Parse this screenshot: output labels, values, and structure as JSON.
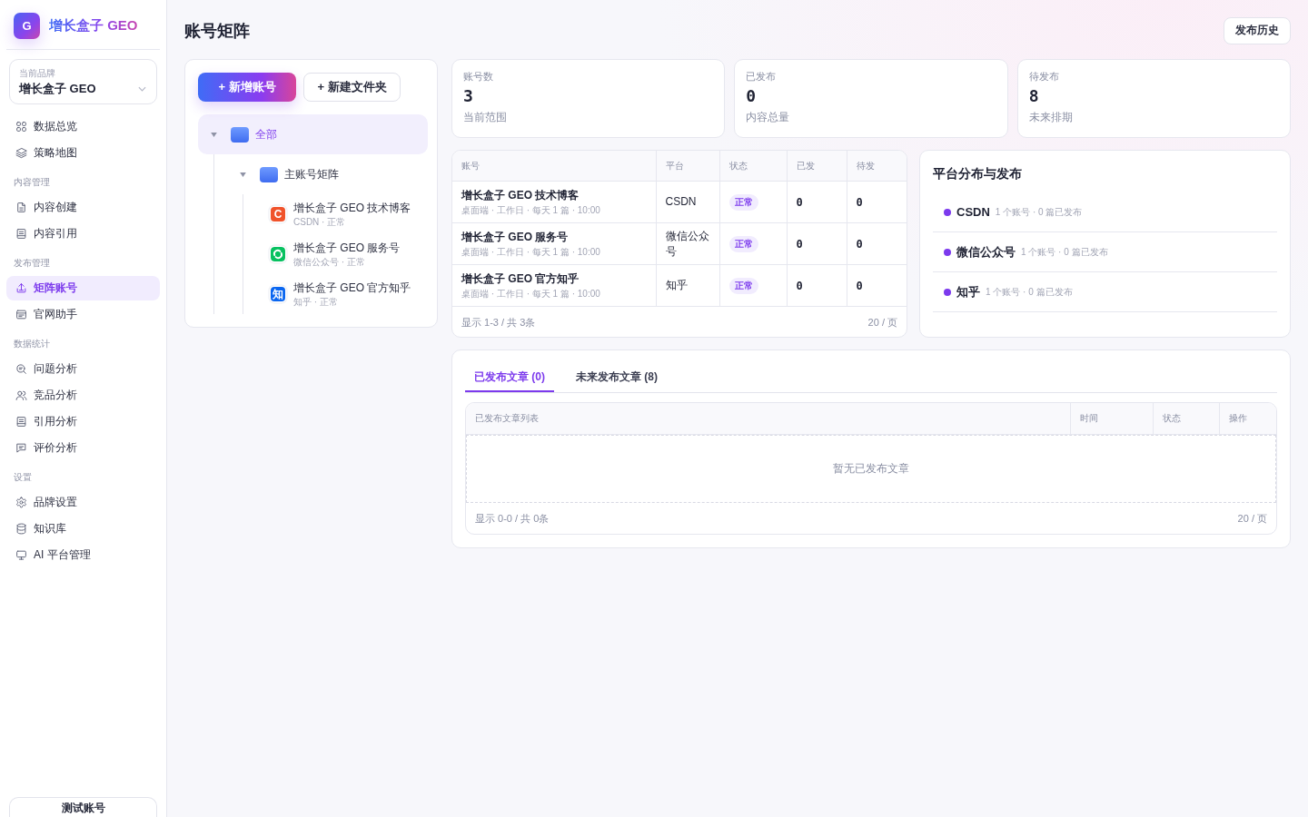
{
  "brand": {
    "logo_letter": "G",
    "name": "增长盒子 GEO"
  },
  "brand_select": {
    "label": "当前品牌",
    "value": "增长盒子 GEO"
  },
  "nav": [
    {
      "items": [
        {
          "label": "数据总览",
          "kind": "grid",
          "selected": false
        },
        {
          "label": "策略地图",
          "kind": "layers",
          "selected": false
        }
      ]
    },
    {
      "title": "内容管理",
      "items": [
        {
          "label": "内容创建",
          "kind": "document",
          "selected": false
        },
        {
          "label": "内容引用",
          "kind": "list",
          "selected": false
        }
      ]
    },
    {
      "title": "发布管理",
      "items": [
        {
          "label": "矩阵账号",
          "kind": "upload",
          "selected": true
        },
        {
          "label": "官网助手",
          "kind": "browser",
          "selected": false
        }
      ]
    },
    {
      "title": "数据统计",
      "items": [
        {
          "label": "问题分析",
          "kind": "search",
          "selected": false
        },
        {
          "label": "竞品分析",
          "kind": "users",
          "selected": false
        },
        {
          "label": "引用分析",
          "kind": "list",
          "selected": false
        },
        {
          "label": "评价分析",
          "kind": "chat",
          "selected": false
        }
      ]
    },
    {
      "title": "设置",
      "items": [
        {
          "label": "品牌设置",
          "kind": "gear",
          "selected": false
        },
        {
          "label": "知识库",
          "kind": "database",
          "selected": false
        },
        {
          "label": "AI 平台管理",
          "kind": "monitor",
          "selected": false
        }
      ]
    }
  ],
  "account_card": {
    "label": "测试账号"
  },
  "page": {
    "title": "账号矩阵",
    "history_button": "发布历史"
  },
  "toolbar": {
    "add_account": "+ 新增账号",
    "new_folder": "+ 新建文件夹"
  },
  "tree": [
    {
      "kind": "folder",
      "label": "全部",
      "expanded": true,
      "selected": true,
      "children": [
        {
          "kind": "folder",
          "label": "主账号矩阵",
          "expanded": true,
          "selected": false,
          "children": [
            {
              "kind": "letter",
              "glyph": "C",
              "label": "增长盒子 GEO 技术博客",
              "meta": "CSDN · 正常",
              "selected": false,
              "color": "#f0532b"
            },
            {
              "kind": "swirl",
              "label": "增长盒子 GEO 服务号",
              "meta": "微信公众号 · 正常",
              "selected": false,
              "color": "#07c160"
            },
            {
              "kind": "letter",
              "glyph": "知",
              "label": "增长盒子 GEO 官方知乎",
              "meta": "知乎 · 正常",
              "selected": false,
              "color": "#0a66f0"
            }
          ]
        }
      ]
    }
  ],
  "stats": [
    {
      "label": "账号数",
      "value": "3",
      "note": "当前范围"
    },
    {
      "label": "已发布",
      "value": "0",
      "note": "内容总量"
    },
    {
      "label": "待发布",
      "value": "8",
      "note": "未来排期"
    }
  ],
  "accounts_table": {
    "columns": [
      "账号",
      "平台",
      "状态",
      "已发",
      "待发"
    ],
    "rows": [
      {
        "name": "增长盒子 GEO 技术博客",
        "schedule": "桌面端 · 工作日 · 每天 1 篇 · 10:00",
        "platform": "CSDN",
        "status": "正常",
        "published": "0",
        "pending": "0"
      },
      {
        "name": "增长盒子 GEO 服务号",
        "schedule": "桌面端 · 工作日 · 每天 1 篇 · 10:00",
        "platform": "微信公众号",
        "status": "正常",
        "published": "0",
        "pending": "0"
      },
      {
        "name": "增长盒子 GEO 官方知乎",
        "schedule": "桌面端 · 工作日 · 每天 1 篇 · 10:00",
        "platform": "知乎",
        "status": "正常",
        "published": "0",
        "pending": "0"
      }
    ],
    "footer": {
      "range": "显示 1-3 / 共 3条",
      "page_size": "20 / 页"
    }
  },
  "platforms": {
    "title": "平台分布与发布",
    "items": [
      {
        "name": "CSDN",
        "meta": "1 个账号 · 0 篇已发布"
      },
      {
        "name": "微信公众号",
        "meta": "1 个账号 · 0 篇已发布"
      },
      {
        "name": "知乎",
        "meta": "1 个账号 · 0 篇已发布"
      }
    ]
  },
  "articles": {
    "tabs": [
      {
        "label": "已发布文章 (0)",
        "selected": true
      },
      {
        "label": "未来发布文章 (8)",
        "selected": false
      }
    ],
    "columns": [
      "已发布文章列表",
      "时间",
      "状态",
      "操作"
    ],
    "empty_text": "暂无已发布文章",
    "footer": {
      "range": "显示 0-0 / 共 0条",
      "page_size": "20 / 页"
    }
  }
}
